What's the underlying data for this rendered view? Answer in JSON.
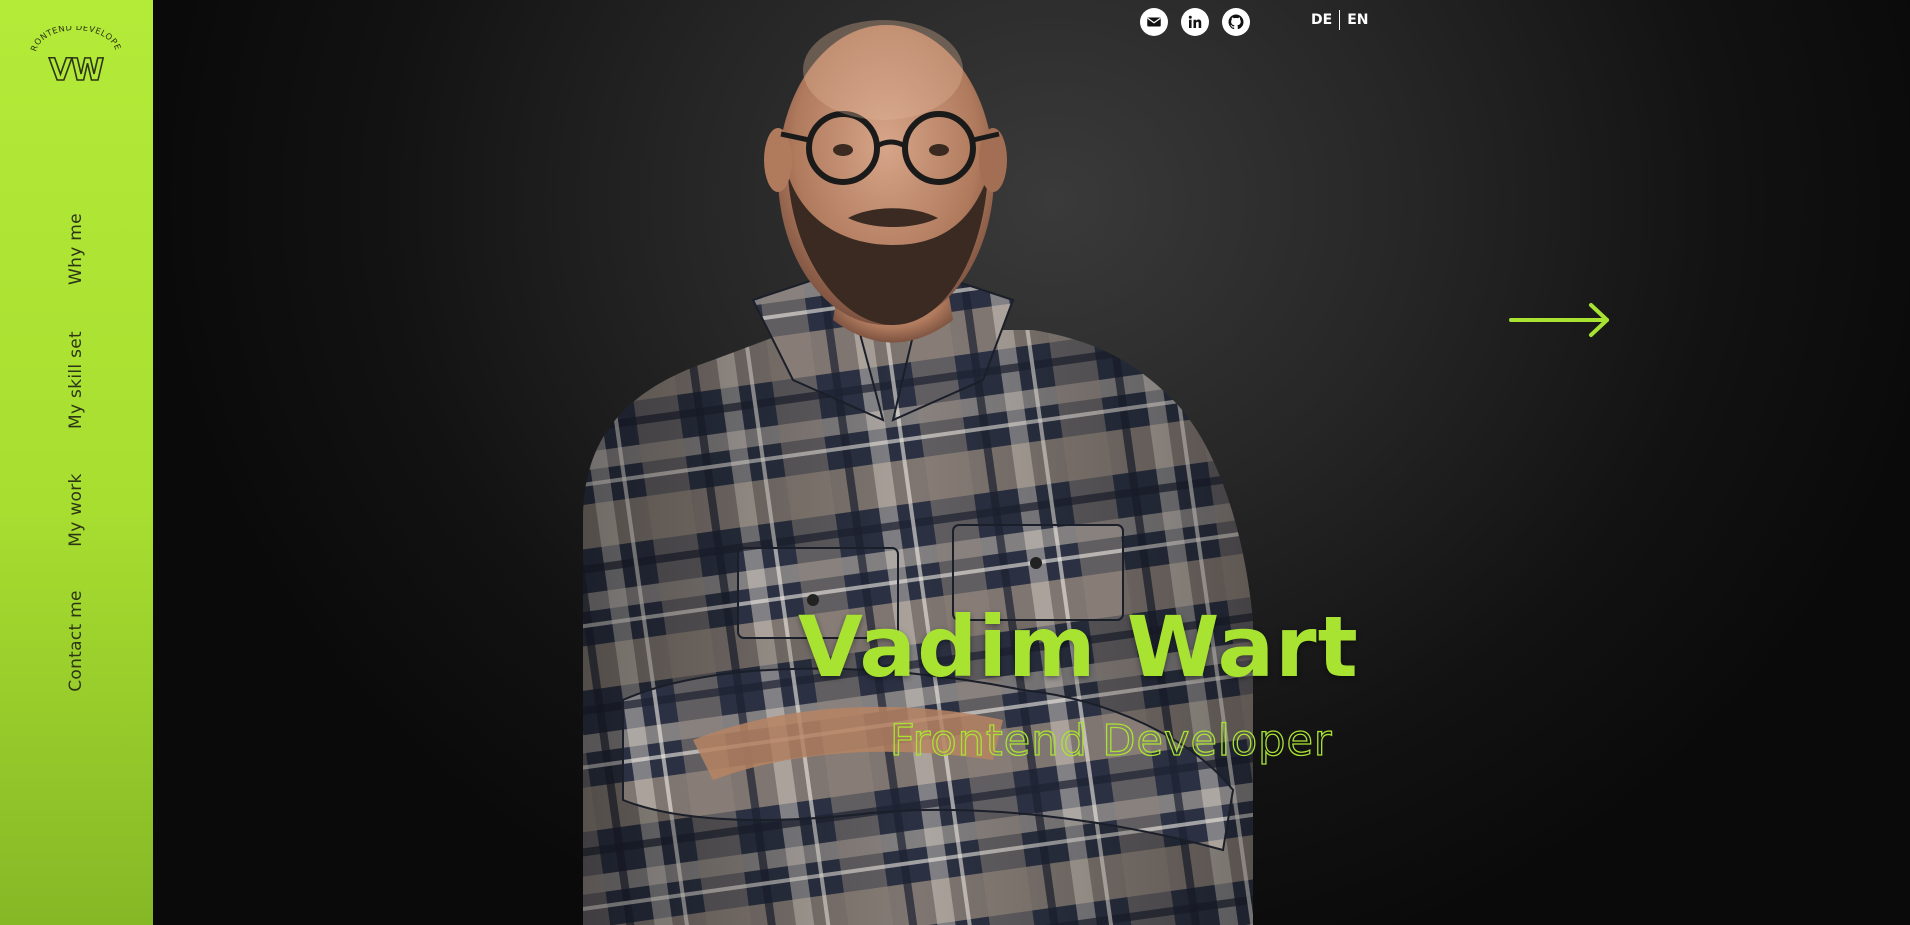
{
  "logo": {
    "tagline": "FRONTEND DEVELOPER",
    "initials": "VW"
  },
  "nav": {
    "items": [
      {
        "label": "Why me"
      },
      {
        "label": "My skill set"
      },
      {
        "label": "My work"
      },
      {
        "label": "Contact me"
      }
    ]
  },
  "socials": [
    {
      "icon": "mail-icon"
    },
    {
      "icon": "linkedin-icon"
    },
    {
      "icon": "github-icon"
    }
  ],
  "language": {
    "options": [
      "DE",
      "EN"
    ]
  },
  "hero": {
    "name": "Vadim Wart",
    "role": "Frontend Developer",
    "next_icon": "arrow-right-icon"
  },
  "colors": {
    "accent": "#a9e332",
    "sidebar": "#b4ea38",
    "background": "#1a1a1a",
    "text": "#ffffff"
  }
}
